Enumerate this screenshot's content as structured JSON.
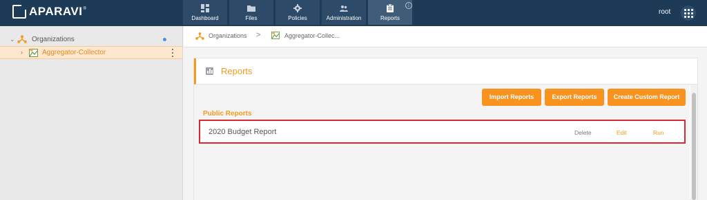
{
  "brand": {
    "name": "APARAVI",
    "trademark": "®"
  },
  "nav": {
    "tabs": [
      {
        "label": "Dashboard",
        "icon": "dashboard-icon"
      },
      {
        "label": "Files",
        "icon": "folder-icon"
      },
      {
        "label": "Policies",
        "icon": "gear-icon"
      },
      {
        "label": "Administration",
        "icon": "users-icon"
      },
      {
        "label": "Reports",
        "icon": "clipboard-icon",
        "active": true
      }
    ]
  },
  "header": {
    "user": "root"
  },
  "sidebar": {
    "root": {
      "label": "Organizations",
      "icon": "organizations-icon"
    },
    "child": {
      "label": "Aggregator-Collector",
      "icon": "collector-icon"
    }
  },
  "breadcrumb": {
    "items": [
      "Organizations",
      "Aggregator-Collec..."
    ],
    "separator": ">"
  },
  "panel": {
    "title": "Reports",
    "buttons": {
      "import": "Import Reports",
      "export": "Export Reports",
      "custom": "Create Custom Report"
    },
    "section_label": "Public Reports",
    "reports": [
      {
        "name": "2020 Budget Report",
        "actions": {
          "delete": "Delete",
          "edit": "Edit",
          "run": "Run"
        }
      }
    ]
  },
  "colors": {
    "topbar": "#1d3a57",
    "accent": "#f49a1e",
    "button": "#f7931e",
    "highlight_border": "#d9282f",
    "selected_row": "#fde8cf"
  }
}
